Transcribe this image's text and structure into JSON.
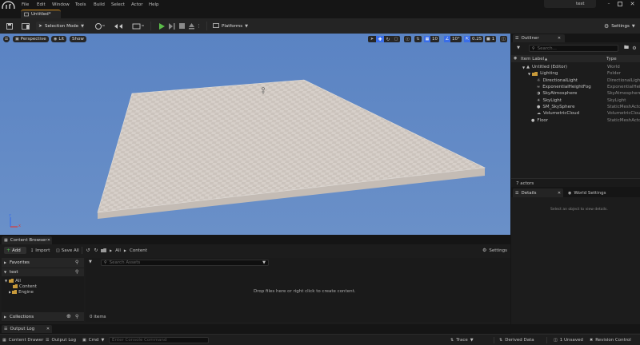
{
  "menubar": {
    "items": [
      "File",
      "Edit",
      "Window",
      "Tools",
      "Build",
      "Select",
      "Actor",
      "Help"
    ],
    "project_name": "test"
  },
  "tabbar": {
    "level_tab": "Untitled*"
  },
  "toolbar": {
    "selection_mode": "Selection Mode",
    "platforms": "Platforms",
    "settings": "Settings"
  },
  "viewport": {
    "perspective": "Perspective",
    "lit": "Lit",
    "show": "Show",
    "grid_snap": "10",
    "rotation_snap": "10°",
    "scale_snap": "0.25",
    "camera_speed": "1",
    "axis_x": "x",
    "axis_z": "z",
    "colors": {
      "sky": "#5b84c4",
      "floor": "#d8d2cc"
    }
  },
  "outliner": {
    "tab": "Outliner",
    "search_placeholder": "Search...",
    "col_label": "Item Label",
    "col_type": "Type",
    "rows": [
      {
        "label": "Untitled (Editor)",
        "type": "World",
        "icon": "world-icon"
      },
      {
        "label": "Lighting",
        "type": "Folder",
        "icon": "folder-icon"
      },
      {
        "label": "DirectionalLight",
        "type": "DirectionalLight",
        "icon": "light-icon"
      },
      {
        "label": "ExponentialHeightFog",
        "type": "ExponentialHeightFog",
        "icon": "fog-icon"
      },
      {
        "label": "SkyAtmosphere",
        "type": "SkyAtmosphere",
        "icon": "atmosphere-icon"
      },
      {
        "label": "SkyLight",
        "type": "SkyLight",
        "icon": "skylight-icon"
      },
      {
        "label": "SM_SkySphere",
        "type": "StaticMeshActor",
        "icon": "mesh-icon"
      },
      {
        "label": "VolumetricCloud",
        "type": "VolumetricCloud",
        "icon": "cloud-icon"
      },
      {
        "label": "Floor",
        "type": "StaticMeshActor",
        "icon": "mesh-icon"
      }
    ],
    "actor_count": "7 actors"
  },
  "details": {
    "tab": "Details",
    "world_settings_tab": "World Settings",
    "empty_message": "Select an object to view details."
  },
  "content_browser": {
    "tab": "Content Browser",
    "add": "Add",
    "import": "Import",
    "save_all": "Save All",
    "breadcrumb": [
      "All",
      "Content"
    ],
    "settings": "Settings",
    "favorites": "Favorites",
    "project": "test",
    "tree": [
      "All",
      "Content",
      "Engine"
    ],
    "collections": "Collections",
    "search_placeholder": "Search Assets",
    "drop_message": "Drop files here or right click to create content.",
    "item_count": "0 items"
  },
  "output_log": {
    "tab": "Output Log"
  },
  "statusbar": {
    "content_drawer": "Content Drawer",
    "output_log": "Output Log",
    "cmd": "Cmd",
    "console_placeholder": "Enter Console Command",
    "trace": "Trace",
    "derived_data": "Derived Data",
    "unsaved": "1 Unsaved",
    "revision_control": "Revision Control"
  }
}
